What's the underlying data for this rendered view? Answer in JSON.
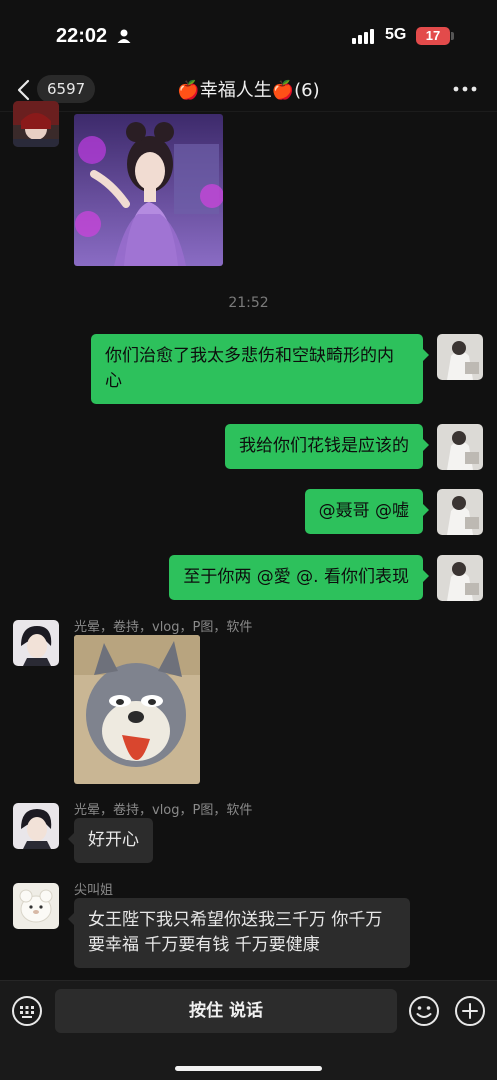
{
  "status_bar": {
    "time": "22:02",
    "network": "5G",
    "battery": "17"
  },
  "nav": {
    "unread_count": "6597",
    "title": "🍎幸福人生🍎(6)"
  },
  "messages": {
    "timestamp": "21:52",
    "me_1": "你们治愈了我太多悲伤和空缺畸形的内心",
    "me_2": "我给你们花钱是应该的",
    "me_3": "@聂哥 @嘘",
    "me_4": "至于你两 @愛 @. 看你们表现",
    "sender_a": "光晕，卷持，vlog，P图，软件",
    "sender_a_2": "光晕，卷持，vlog，P图，软件",
    "msg_a_text": "好开心",
    "sender_b": "尖叫姐",
    "msg_b_text": "女王陛下我只希望你送我三千万 你千万要幸福 千万要有钱 千万要健康"
  },
  "input_bar": {
    "voice_label": "按住 说话"
  },
  "colors": {
    "bg": "#111111",
    "green_bubble": "#2dc15c",
    "grey_bubble": "#2c2c2c",
    "battery_red": "#e34b4b"
  },
  "icons": [
    "person-icon",
    "signal-icon",
    "back-icon",
    "more-icon",
    "keyboard-icon",
    "emoji-icon",
    "plus-icon"
  ]
}
